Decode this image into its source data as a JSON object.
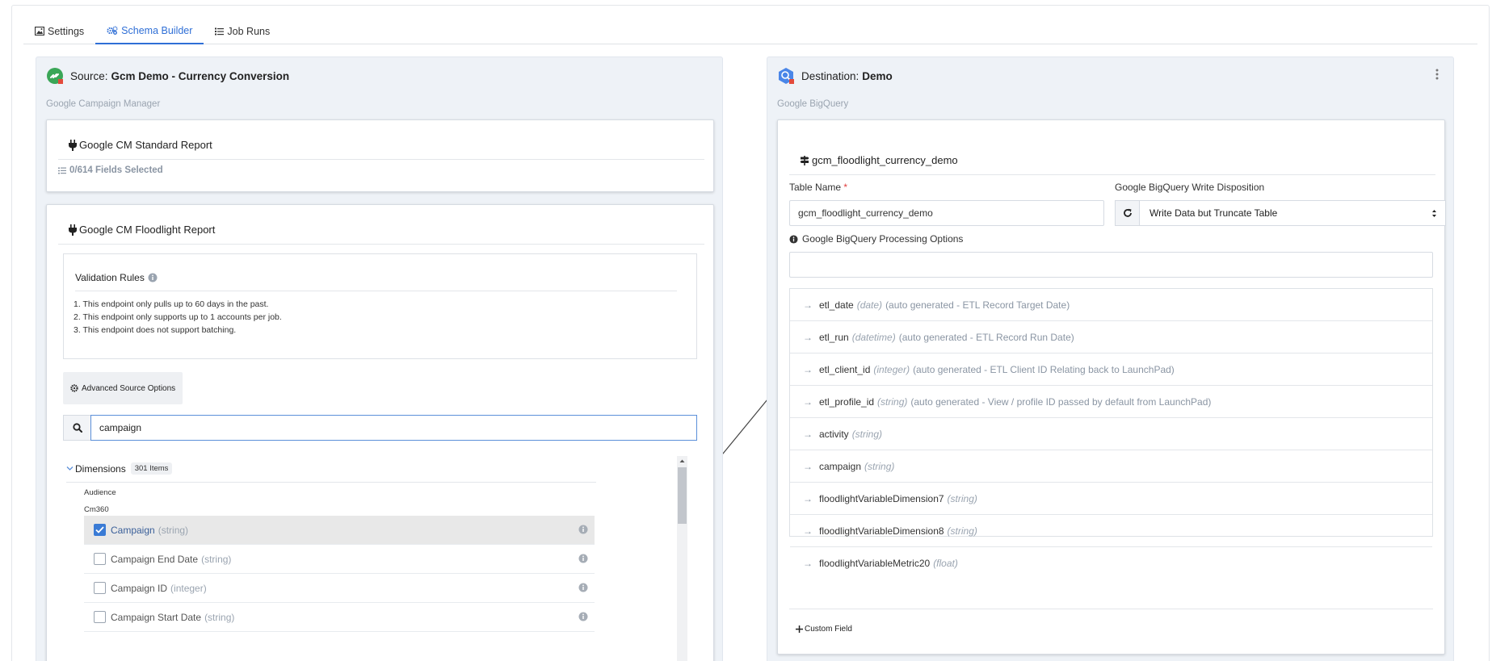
{
  "tabs": [
    {
      "label": "Settings",
      "icon": "image-icon"
    },
    {
      "label": "Schema Builder",
      "icon": "gears-icon",
      "active": true
    },
    {
      "label": "Job Runs",
      "icon": "list-icon"
    }
  ],
  "source": {
    "prefix": "Source:",
    "name": "Gcm Demo - Currency Conversion",
    "connector": "Google Campaign Manager",
    "standard_report": {
      "title": "Google CM Standard Report",
      "fields_selected": "0/614 Fields Selected"
    },
    "floodlight_report": {
      "title": "Google CM Floodlight Report",
      "validation_title": "Validation Rules",
      "rules": [
        "1. This endpoint only pulls up to 60 days in the past.",
        "2. This endpoint only supports up to 1 accounts per job.",
        "3. This endpoint does not support batching."
      ],
      "advanced_options_label": "Advanced Source Options",
      "search_value": "campaign",
      "dimensions_label": "Dimensions",
      "dimensions_count": "301 Items",
      "groups": [
        "Audience",
        "Cm360"
      ],
      "fields": [
        {
          "name": "Campaign",
          "type": "(string)",
          "checked": true
        },
        {
          "name": "Campaign End Date",
          "type": "(string)",
          "checked": false
        },
        {
          "name": "Campaign ID",
          "type": "(integer)",
          "checked": false
        },
        {
          "name": "Campaign Start Date",
          "type": "(string)",
          "checked": false
        }
      ]
    }
  },
  "destination": {
    "prefix": "Destination:",
    "name": "Demo",
    "connector": "Google BigQuery",
    "table_heading": "gcm_floodlight_currency_demo",
    "table_name_label": "Table Name",
    "table_name_value": "gcm_floodlight_currency_demo",
    "write_disposition_label": "Google BigQuery Write Disposition",
    "write_disposition_value": "Write Data but Truncate Table",
    "processing_label": "Google BigQuery Processing Options",
    "processing_value": "",
    "fields": [
      {
        "name": "etl_date",
        "type": "(date)",
        "desc": "(auto generated - ETL Record Target Date)"
      },
      {
        "name": "etl_run",
        "type": "(datetime)",
        "desc": "(auto generated - ETL Record Run Date)"
      },
      {
        "name": "etl_client_id",
        "type": "(integer)",
        "desc": "(auto generated - ETL Client ID Relating back to LaunchPad)"
      },
      {
        "name": "etl_profile_id",
        "type": "(string)",
        "desc": "(auto generated - View / profile ID passed by default from LaunchPad)"
      },
      {
        "name": "activity",
        "type": "(string)",
        "desc": ""
      },
      {
        "name": "campaign",
        "type": "(string)",
        "desc": ""
      },
      {
        "name": "floodlightVariableDimension7",
        "type": "(string)",
        "desc": ""
      },
      {
        "name": "floodlightVariableDimension8",
        "type": "(string)",
        "desc": ""
      },
      {
        "name": "floodlightVariableMetric20",
        "type": "(float)",
        "desc": ""
      }
    ],
    "custom_field_label": "Custom Field"
  },
  "colors": {
    "accent": "#2f6fd6",
    "panel_bg": "#eef2f7",
    "checkbox": "#3a7bd5",
    "required": "#e03c3c"
  }
}
